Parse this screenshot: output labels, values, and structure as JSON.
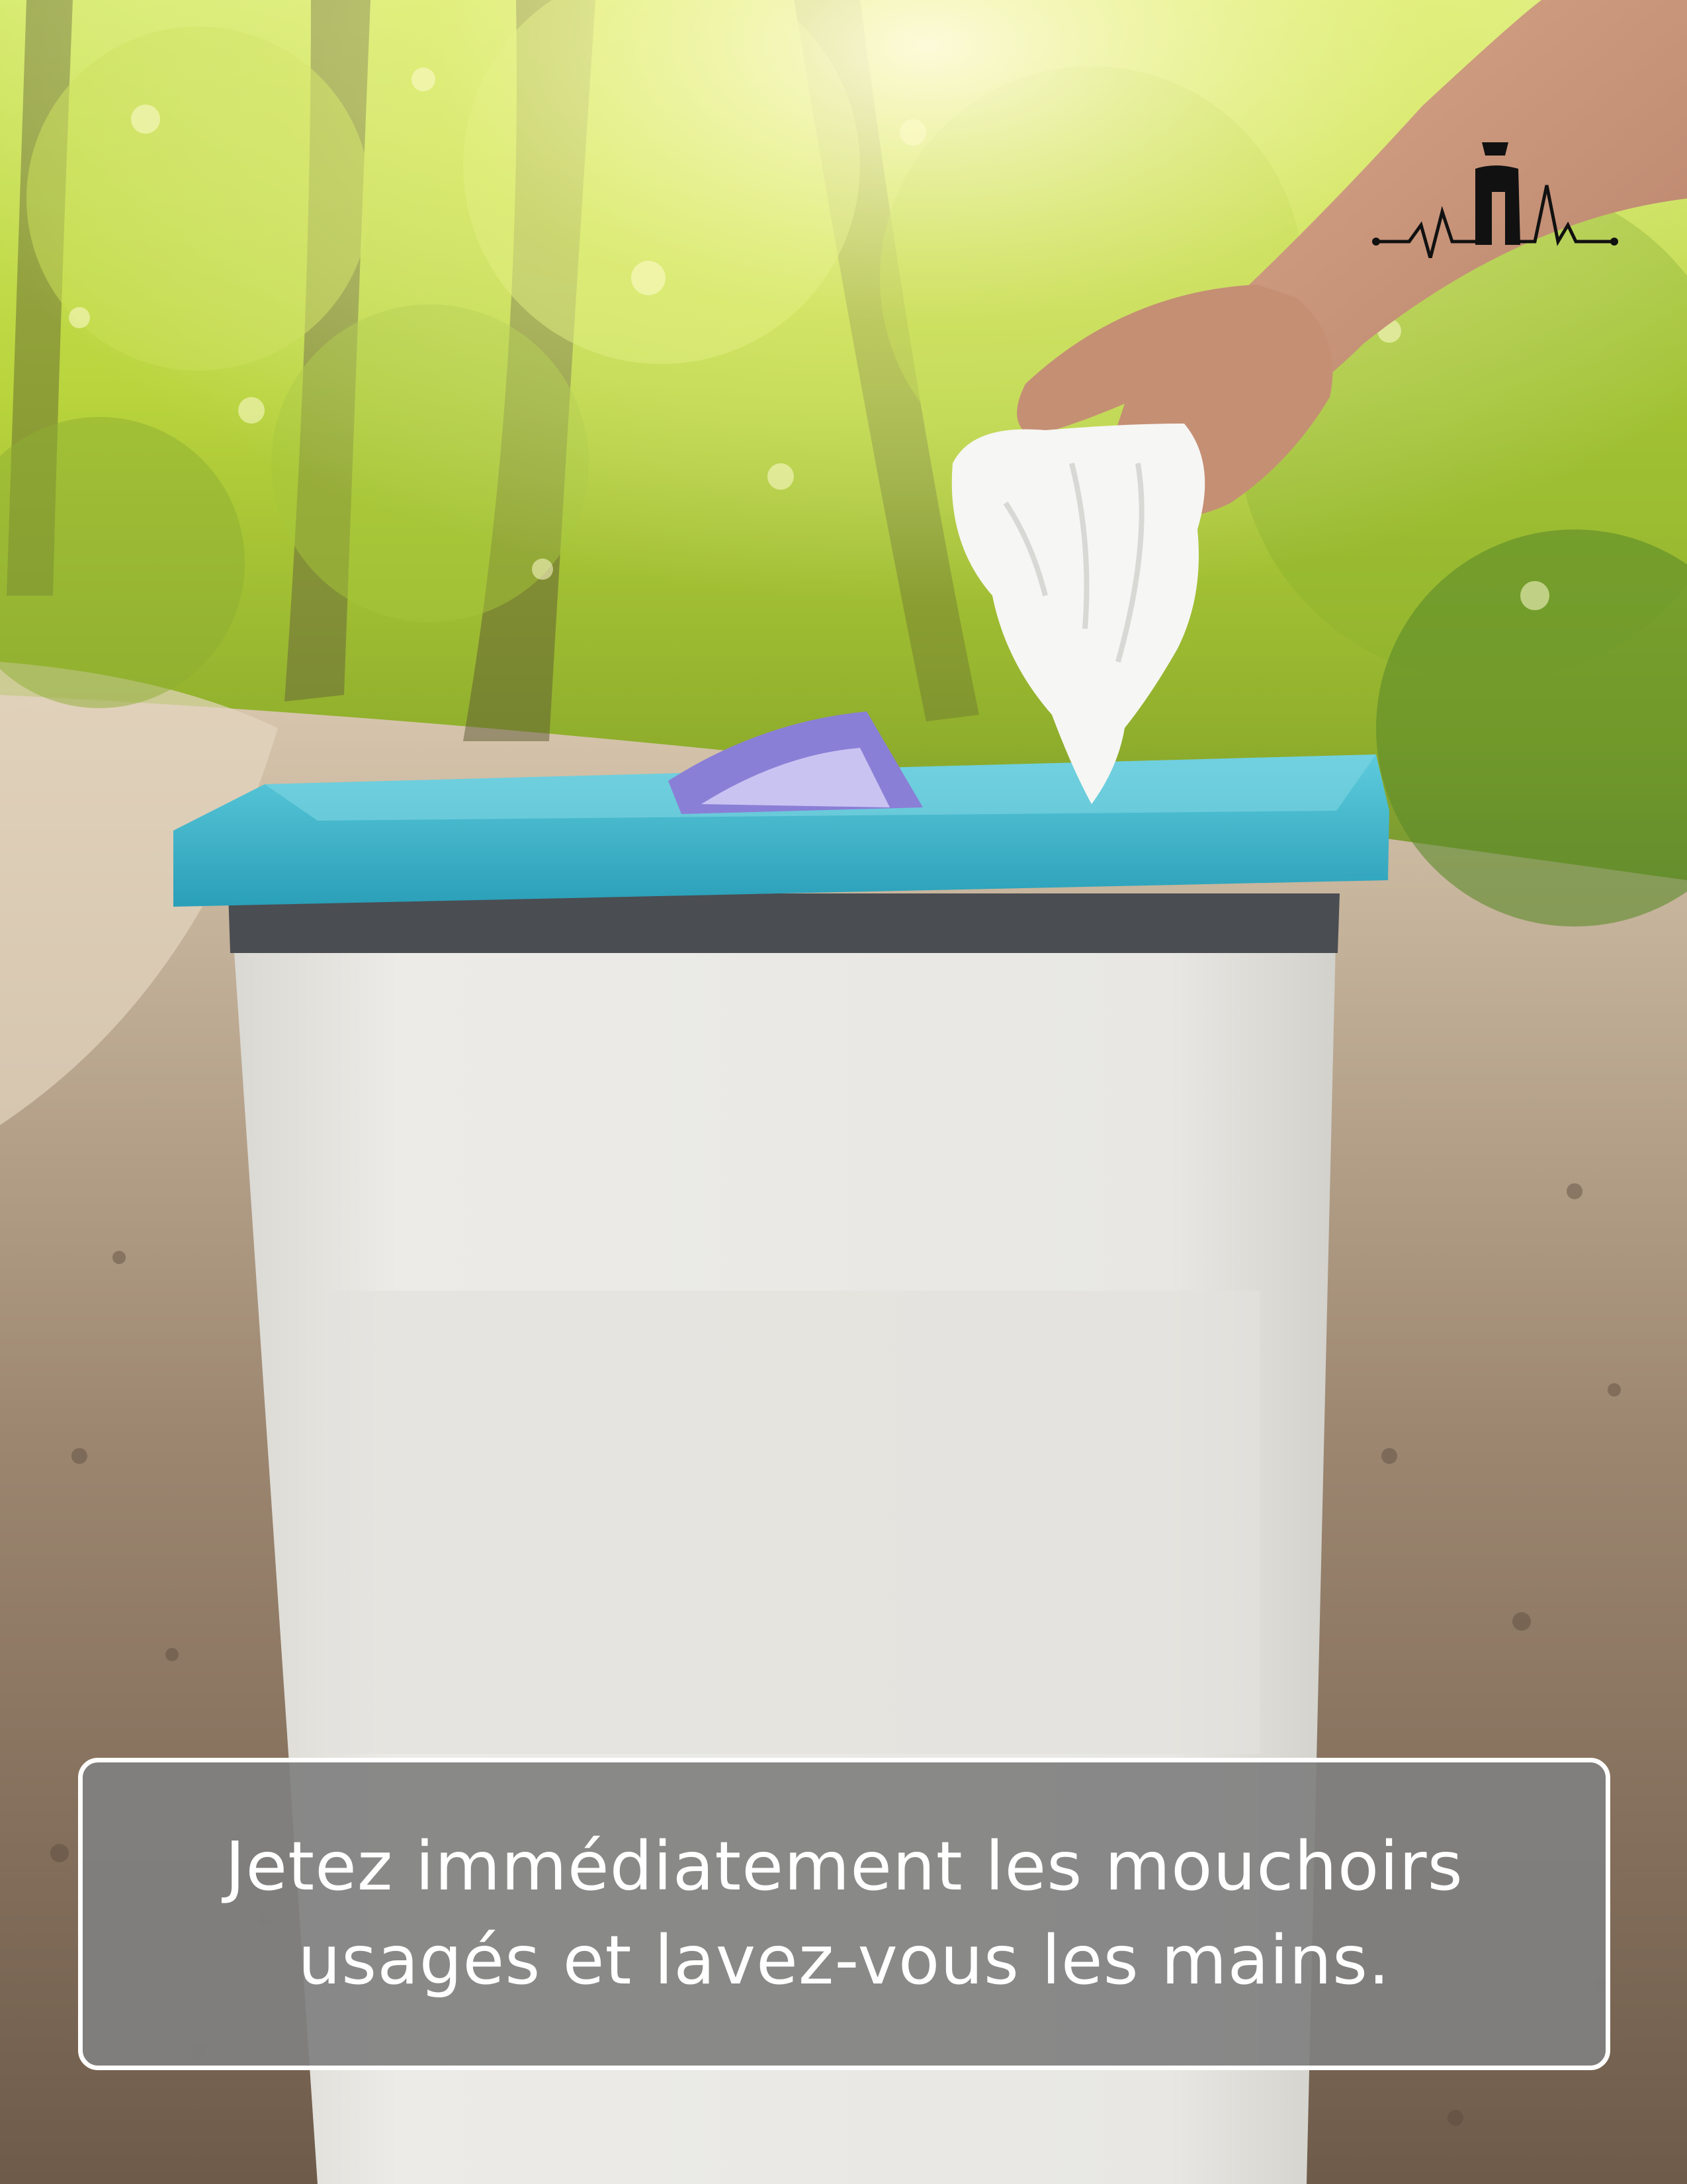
{
  "caption": {
    "line1": "Jetez immédiatement les mouchoirs",
    "line2": "usagés et lavez-vous les mains."
  },
  "logo": {
    "icon": "heartbeat-person-icon"
  },
  "colors": {
    "foliage": "#cfe04a",
    "bin_body": "#e9e8e4",
    "bin_bag": "#39b3c9",
    "caption_bg": "#808080",
    "caption_text": "#ffffff"
  }
}
